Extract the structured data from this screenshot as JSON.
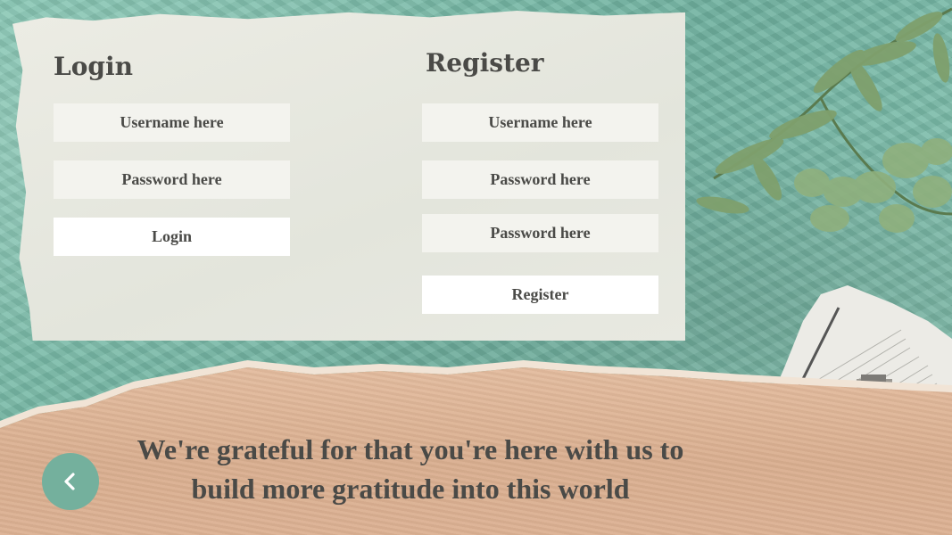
{
  "login": {
    "title": "Login",
    "username_placeholder": "Username here",
    "password_placeholder": "Password here",
    "submit_label": "Login"
  },
  "register": {
    "title": "Register",
    "username_placeholder": "Username here",
    "password_placeholder": "Password here",
    "confirm_password_placeholder": "Password here",
    "submit_label": "Register"
  },
  "tagline": {
    "line1": "We're grateful for that you're here with us to",
    "line2": "build more gratitude into this world"
  },
  "back_button": {
    "icon": "chevron-left-icon"
  },
  "colors": {
    "background_teal": "#7cbcaa",
    "panel_paper": "#e8e9e1",
    "kraft_paper": "#dcb193",
    "text_dark": "#4a4a47",
    "back_button": "#74b09d"
  }
}
